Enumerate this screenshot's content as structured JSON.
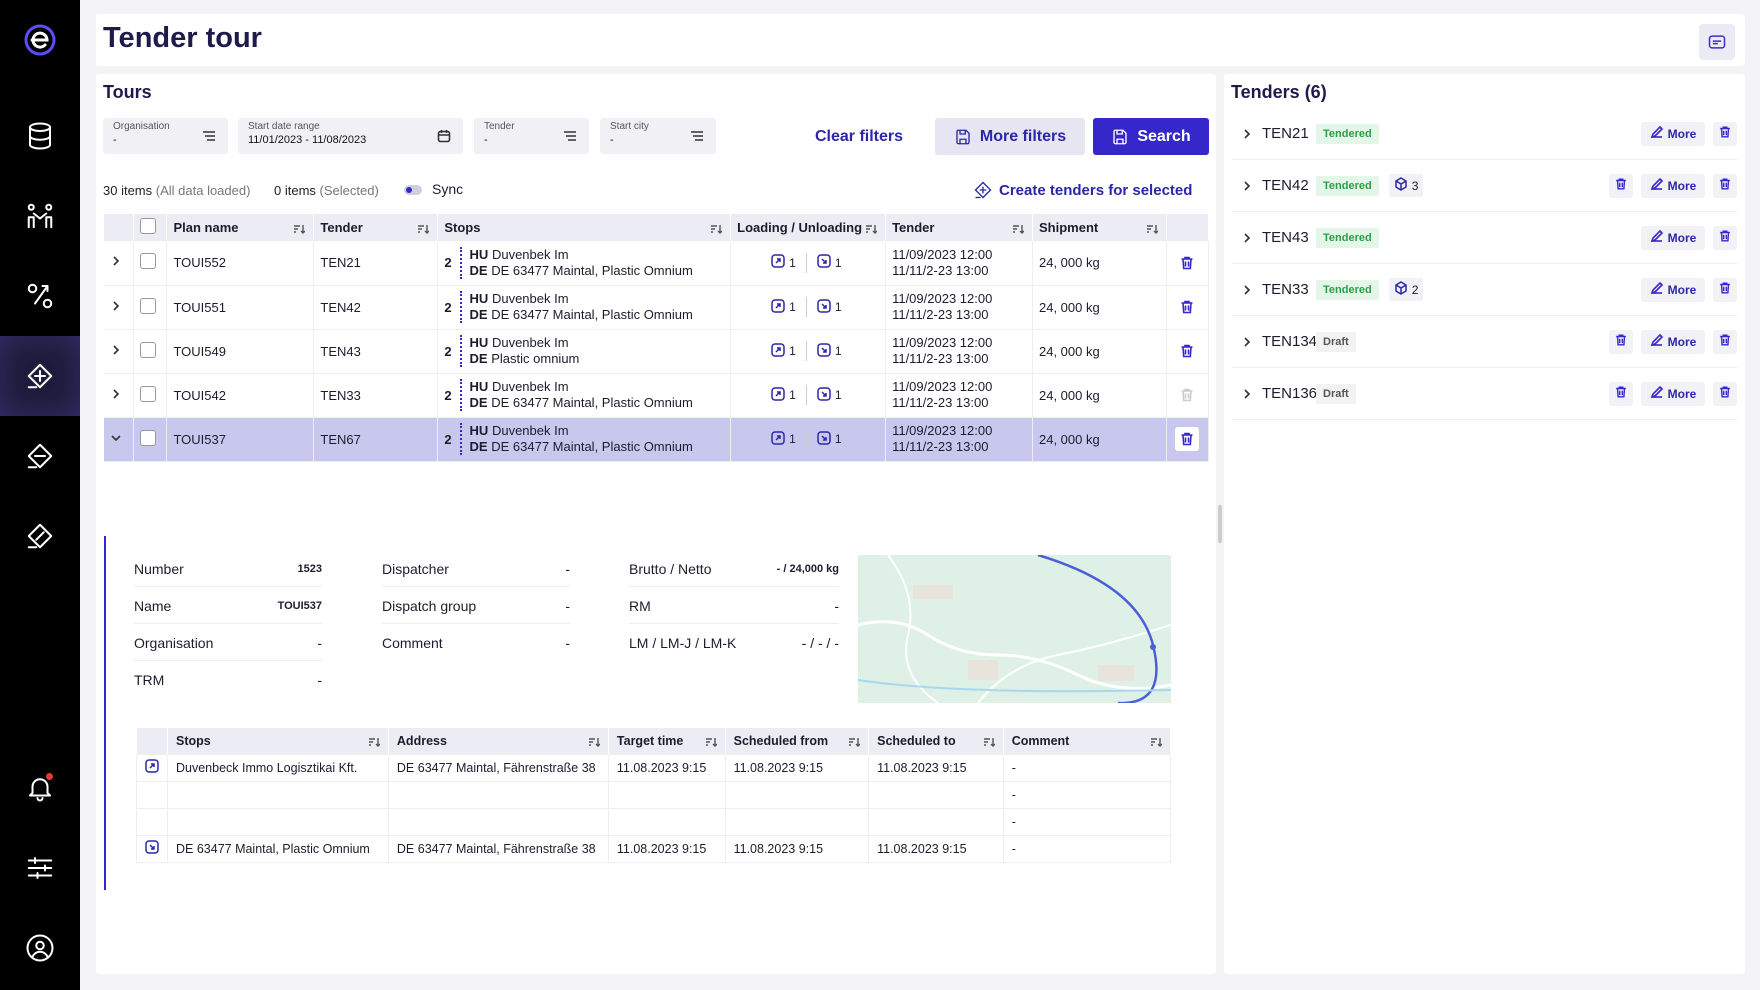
{
  "header": {
    "title": "Tender tour"
  },
  "tours": {
    "title": "Tours",
    "filters": [
      {
        "label": "Organisation",
        "value": "-"
      },
      {
        "label": "Start date range",
        "value": "11/01/2023 - 11/08/2023"
      },
      {
        "label": "Tender",
        "value": "-"
      },
      {
        "label": "Start city",
        "value": "-"
      }
    ],
    "clear_filters": "Clear filters",
    "more_filters": "More filters",
    "search": "Search",
    "items_count": "30 items",
    "items_note": "(All data loaded)",
    "selected_count": "0 items",
    "selected_note": "(Selected)",
    "sync_label": "Sync",
    "create_tenders": "Create tenders for selected",
    "columns": [
      "Plan name",
      "Tender",
      "Stops",
      "Loading / Unloading",
      "Tender",
      "Shipment"
    ],
    "rows": [
      {
        "plan": "TOUI552",
        "tender": "TEN21",
        "stops_count": "2",
        "from_code": "HU",
        "from": "Duvenbek Im",
        "to_code": "DE",
        "to": "DE 63477 Maintal, Plastic Omnium",
        "load": "1",
        "unload": "1",
        "date1": "11/09/2023 12:00",
        "date2": "11/11/2-23 13:00",
        "shipment": "24, 000 kg",
        "trash_enabled": true
      },
      {
        "plan": "TOUI551",
        "tender": "TEN42",
        "stops_count": "2",
        "from_code": "HU",
        "from": "Duvenbek Im",
        "to_code": "DE",
        "to": "DE 63477 Maintal, Plastic Omnium",
        "load": "1",
        "unload": "1",
        "date1": "11/09/2023 12:00",
        "date2": "11/11/2-23 13:00",
        "shipment": "24, 000 kg",
        "trash_enabled": true
      },
      {
        "plan": "TOUI549",
        "tender": "TEN43",
        "stops_count": "2",
        "from_code": "HU",
        "from": "Duvenbek Im",
        "to_code": "DE",
        "to": "Plastic omnium",
        "load": "1",
        "unload": "1",
        "date1": "11/09/2023 12:00",
        "date2": "11/11/2-23 13:00",
        "shipment": "24, 000 kg",
        "trash_enabled": true
      },
      {
        "plan": "TOUI542",
        "tender": "TEN33",
        "stops_count": "2",
        "from_code": "HU",
        "from": "Duvenbek Im",
        "to_code": "DE",
        "to": "DE 63477 Maintal, Plastic Omnium",
        "load": "1",
        "unload": "1",
        "date1": "11/09/2023 12:00",
        "date2": "11/11/2-23 13:00",
        "shipment": "24, 000 kg",
        "trash_enabled": false
      },
      {
        "plan": "TOUI537",
        "tender": "TEN67",
        "stops_count": "2",
        "from_code": "HU",
        "from": "Duvenbek Im",
        "to_code": "DE",
        "to": "DE 63477 Maintal, Plastic Omnium",
        "load": "1",
        "unload": "1",
        "date1": "11/09/2023 12:00",
        "date2": "11/11/2-23 13:00",
        "shipment": "24, 000 kg",
        "trash_enabled": true,
        "selected": true
      }
    ],
    "detail": {
      "col1": [
        {
          "label": "Number",
          "value": "1523"
        },
        {
          "label": "Name",
          "value": "TOUI537"
        },
        {
          "label": "Organisation",
          "value": "-"
        },
        {
          "label": "TRM",
          "value": "-"
        }
      ],
      "col2": [
        {
          "label": "Dispatcher",
          "value": "-"
        },
        {
          "label": "Dispatch group",
          "value": "-"
        },
        {
          "label": "Comment",
          "value": "-"
        }
      ],
      "col3": [
        {
          "label": "Brutto / Netto",
          "value": "- / 24,000 kg"
        },
        {
          "label": "RM",
          "value": "-"
        },
        {
          "label": "LM / LM-J / LM-K",
          "value": "- / - / -"
        }
      ],
      "stop_columns": [
        "Stops",
        "Address",
        "Target time",
        "Scheduled from",
        "Scheduled to",
        "Comment"
      ],
      "stops": [
        {
          "icon": "loading-icon",
          "stop": "Duvenbeck Immo Logisztikai Kft.",
          "address": "DE 63477 Maintal, Fährenstraße 38",
          "target": "11.08.2023 9:15",
          "from": "11.08.2023 9:15",
          "to": "11.08.2023 9:15",
          "comment": "-"
        },
        {
          "icon": "",
          "stop": "",
          "address": "",
          "target": "",
          "from": "",
          "to": "",
          "comment": "-"
        },
        {
          "icon": "",
          "stop": "",
          "address": "",
          "target": "",
          "from": "",
          "to": "",
          "comment": "-"
        },
        {
          "icon": "unloading-icon",
          "stop": "DE 63477 Maintal, Plastic Omnium",
          "address": "DE 63477 Maintal, Fährenstraße 38",
          "target": "11.08.2023 9:15",
          "from": "11.08.2023 9:15",
          "to": "11.08.2023 9:15",
          "comment": "-"
        }
      ]
    }
  },
  "tenders": {
    "title": "Tenders (6)",
    "more_label": "More",
    "items": [
      {
        "name": "TEN21",
        "status": "Tendered",
        "status_type": "tendered",
        "packages": "",
        "extra_trash": false
      },
      {
        "name": "TEN42",
        "status": "Tendered",
        "status_type": "tendered",
        "packages": "3",
        "extra_trash": true
      },
      {
        "name": "TEN43",
        "status": "Tendered",
        "status_type": "tendered",
        "packages": "",
        "extra_trash": false
      },
      {
        "name": "TEN33",
        "status": "Tendered",
        "status_type": "tendered",
        "packages": "2",
        "extra_trash": false
      },
      {
        "name": "TEN134",
        "status": "Draft",
        "status_type": "draft",
        "packages": "",
        "extra_trash": true
      },
      {
        "name": "TEN136",
        "status": "Draft",
        "status_type": "draft",
        "packages": "",
        "extra_trash": true
      }
    ]
  },
  "colors": {
    "accent": "#3527c9",
    "selected_row": "#c8c8ef",
    "tendered": "#2e9d48",
    "sidebar": "#000000"
  }
}
